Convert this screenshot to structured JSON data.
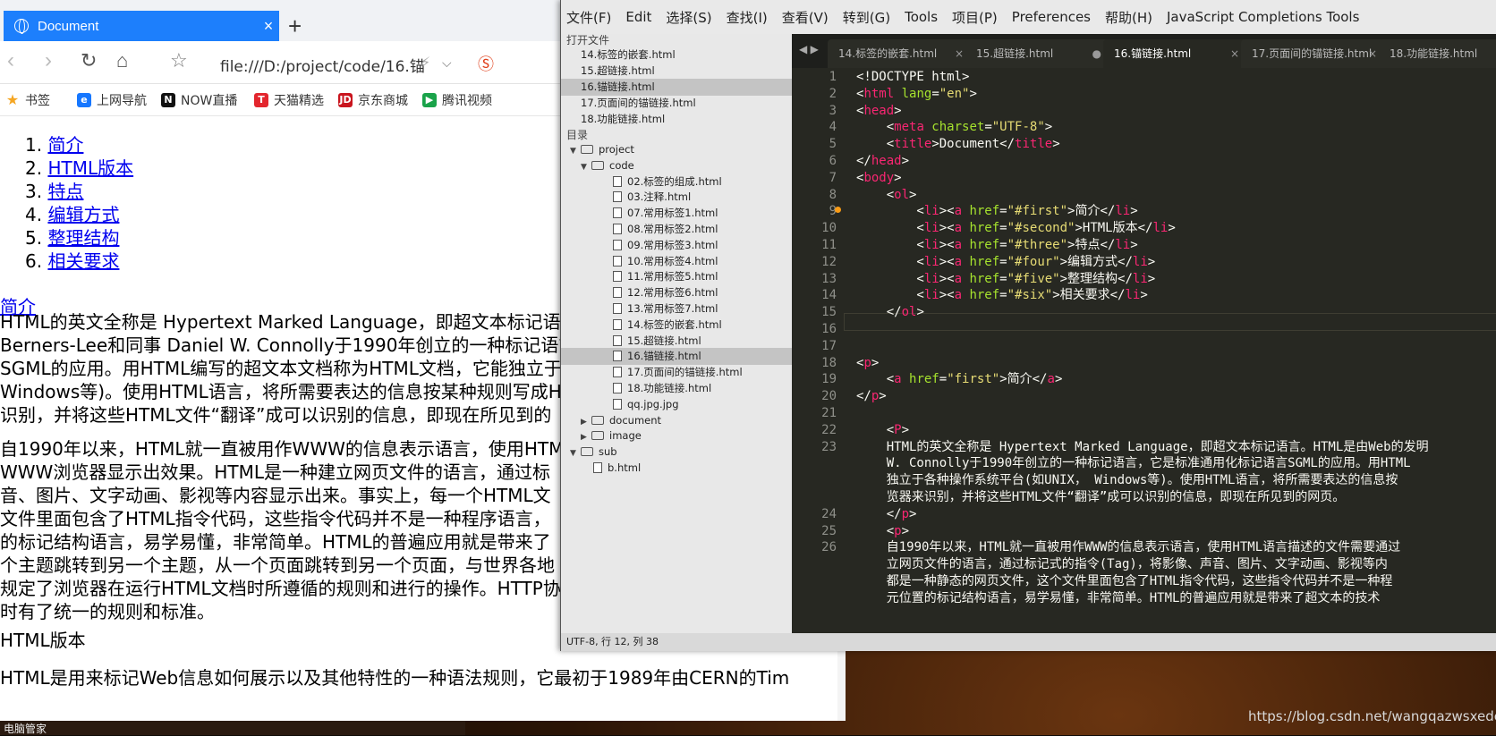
{
  "browser": {
    "tab_title": "Document",
    "url": "file:///D:/project/code/16.锚",
    "bookmarks": [
      "书签",
      "上网导航",
      "NOW直播",
      "天猫精选",
      "京东商城",
      "腾讯视频"
    ],
    "toc": [
      "1. 简介",
      "2. HTML版本",
      "3. 特点",
      "4. 编辑方式",
      "5. 整理结构",
      "6. 相关要求"
    ],
    "jump_link": "简介",
    "para1": "HTML的英文全称是 Hypertext Marked Language，即超文本标记语言\nBerners-Lee和同事 Daniel W. Connolly于1990年创立的一种标记语言\nSGML的应用。用HTML编写的超文本文档称为HTML文档，它能独立于\nWindows等)。使用HTML语言，将所需要表达的信息按某种规则写成H\n识别，并将这些HTML文件“翻译”成可以识别的信息，即现在所见到的",
    "para2": "自1990年以来，HTML就一直被用作WWW的信息表示语言，使用HTM\nWWW浏览器显示出效果。HTML是一种建立网页文件的语言，通过标\n音、图片、文字动画、影视等内容显示出来。事实上，每一个HTML文\n文件里面包含了HTML指令代码，这些指令代码并不是一种程序语言，\n的标记结构语言，易学易懂，非常简单。HTML的普遍应用就是带来了\n个主题跳转到另一个主题，从一个页面跳转到另一个页面，与世界各地\n规定了浏览器在运行HTML文档时所遵循的规则和进行的操作。HTTP协\n时有了统一的规则和标准。",
    "heading2": "HTML版本",
    "para3": "HTML是用来标记Web信息如何展示以及其他特性的一种语法规则，它最初于1989年由CERN的Tim"
  },
  "editor": {
    "menu": [
      "文件(F)",
      "Edit",
      "选择(S)",
      "查找(I)",
      "查看(V)",
      "转到(G)",
      "Tools",
      "项目(P)",
      "Preferences",
      "帮助(H)",
      "JavaScript Completions Tools"
    ],
    "sidebar_open_label": "打开文件",
    "open_files": [
      "14.标签的嵌套.html",
      "15.超链接.html",
      "16.锚链接.html",
      "17.页面间的锚链接.html",
      "18.功能链接.html"
    ],
    "folders_label": "目录",
    "tree": [
      {
        "label": "project",
        "level": 0,
        "kind": "folder-open"
      },
      {
        "label": "code",
        "level": 1,
        "kind": "folder-open"
      },
      {
        "label": "02.标签的组成.html",
        "level": 2,
        "kind": "file"
      },
      {
        "label": "03.注释.html",
        "level": 2,
        "kind": "file"
      },
      {
        "label": "07.常用标签1.html",
        "level": 2,
        "kind": "file"
      },
      {
        "label": "08.常用标签2.html",
        "level": 2,
        "kind": "file"
      },
      {
        "label": "09.常用标签3.html",
        "level": 2,
        "kind": "file"
      },
      {
        "label": "10.常用标签4.html",
        "level": 2,
        "kind": "file"
      },
      {
        "label": "11.常用标签5.html",
        "level": 2,
        "kind": "file"
      },
      {
        "label": "12.常用标签6.html",
        "level": 2,
        "kind": "file"
      },
      {
        "label": "13.常用标签7.html",
        "level": 2,
        "kind": "file"
      },
      {
        "label": "14.标签的嵌套.html",
        "level": 2,
        "kind": "file"
      },
      {
        "label": "15.超链接.html",
        "level": 2,
        "kind": "file"
      },
      {
        "label": "16.锚链接.html",
        "level": 2,
        "kind": "file",
        "selected": true
      },
      {
        "label": "17.页面间的锚链接.html",
        "level": 2,
        "kind": "file"
      },
      {
        "label": "18.功能链接.html",
        "level": 2,
        "kind": "file"
      },
      {
        "label": "qq.jpg.jpg",
        "level": 2,
        "kind": "image"
      },
      {
        "label": "document",
        "level": 1,
        "kind": "folder"
      },
      {
        "label": "image",
        "level": 1,
        "kind": "folder"
      },
      {
        "label": "sub",
        "level": 0,
        "kind": "folder-open"
      },
      {
        "label": "b.html",
        "level": 1,
        "kind": "file"
      }
    ],
    "tabs": [
      {
        "label": "14.标签的嵌套.html",
        "close": "×"
      },
      {
        "label": "15.超链接.html",
        "close": "●"
      },
      {
        "label": "16.锚链接.html",
        "close": "×",
        "active": true
      },
      {
        "label": "17.页面间的锚链接.html",
        "close": "×"
      },
      {
        "label": "18.功能链接.html",
        "close": "×"
      }
    ],
    "gutter": [
      "1",
      "2",
      "3",
      "4",
      "5",
      "6",
      "7",
      "8",
      "9",
      "10",
      "11",
      "12",
      "13",
      "14",
      "15",
      "16",
      "17",
      "18",
      "19",
      "20",
      "21",
      "22",
      "23",
      "",
      "",
      "",
      "24",
      "25",
      "26"
    ],
    "status": "UTF-8, 行 12, 列 38"
  },
  "code_lines": [
    [
      [
        "w",
        "<!DOCTYPE html>"
      ]
    ],
    [
      [
        "w",
        "<"
      ],
      [
        "t",
        "html"
      ],
      [
        "a",
        " lang"
      ],
      [
        "w",
        "="
      ],
      [
        "s",
        "\"en\""
      ],
      [
        "w",
        ">"
      ]
    ],
    [
      [
        "w",
        "<"
      ],
      [
        "t",
        "head"
      ],
      [
        "w",
        ">"
      ]
    ],
    [
      [
        "w",
        "    <"
      ],
      [
        "t",
        "meta"
      ],
      [
        "a",
        " charset"
      ],
      [
        "w",
        "="
      ],
      [
        "s",
        "\"UTF-8\""
      ],
      [
        "w",
        ">"
      ]
    ],
    [
      [
        "w",
        "    <"
      ],
      [
        "t",
        "title"
      ],
      [
        "w",
        ">Document</"
      ],
      [
        "t",
        "title"
      ],
      [
        "w",
        ">"
      ]
    ],
    [
      [
        "w",
        "</"
      ],
      [
        "t",
        "head"
      ],
      [
        "w",
        ">"
      ]
    ],
    [
      [
        "w",
        "<"
      ],
      [
        "t",
        "body"
      ],
      [
        "w",
        ">"
      ]
    ],
    [
      [
        "w",
        "    <"
      ],
      [
        "t",
        "ol"
      ],
      [
        "w",
        ">"
      ]
    ],
    [
      [
        "w",
        "        <"
      ],
      [
        "t",
        "li"
      ],
      [
        "w",
        "><"
      ],
      [
        "t",
        "a"
      ],
      [
        "a",
        " href"
      ],
      [
        "w",
        "="
      ],
      [
        "s",
        "\"#first\""
      ],
      [
        "w",
        ">简介</"
      ],
      [
        "t",
        "li"
      ],
      [
        "w",
        ">"
      ]
    ],
    [
      [
        "w",
        "        <"
      ],
      [
        "t",
        "li"
      ],
      [
        "w",
        "><"
      ],
      [
        "t",
        "a"
      ],
      [
        "a",
        " href"
      ],
      [
        "w",
        "="
      ],
      [
        "s",
        "\"#second\""
      ],
      [
        "w",
        ">HTML版本</"
      ],
      [
        "t",
        "li"
      ],
      [
        "w",
        ">"
      ]
    ],
    [
      [
        "w",
        "        <"
      ],
      [
        "t",
        "li"
      ],
      [
        "w",
        "><"
      ],
      [
        "t",
        "a"
      ],
      [
        "a",
        " href"
      ],
      [
        "w",
        "="
      ],
      [
        "s",
        "\"#three\""
      ],
      [
        "w",
        ">特点</"
      ],
      [
        "t",
        "li"
      ],
      [
        "w",
        ">"
      ]
    ],
    [
      [
        "w",
        "        <"
      ],
      [
        "t",
        "li"
      ],
      [
        "w",
        "><"
      ],
      [
        "t",
        "a"
      ],
      [
        "a",
        " href"
      ],
      [
        "w",
        "="
      ],
      [
        "s",
        "\"#four\""
      ],
      [
        "w",
        ">编辑方式</"
      ],
      [
        "t",
        "li"
      ],
      [
        "w",
        ">"
      ]
    ],
    [
      [
        "w",
        "        <"
      ],
      [
        "t",
        "li"
      ],
      [
        "w",
        "><"
      ],
      [
        "t",
        "a"
      ],
      [
        "a",
        " href"
      ],
      [
        "w",
        "="
      ],
      [
        "s",
        "\"#five\""
      ],
      [
        "w",
        ">整理结构</"
      ],
      [
        "t",
        "li"
      ],
      [
        "w",
        ">"
      ]
    ],
    [
      [
        "w",
        "        <"
      ],
      [
        "t",
        "li"
      ],
      [
        "w",
        "><"
      ],
      [
        "t",
        "a"
      ],
      [
        "a",
        " href"
      ],
      [
        "w",
        "="
      ],
      [
        "s",
        "\"#six\""
      ],
      [
        "w",
        ">相关要求</"
      ],
      [
        "t",
        "li"
      ],
      [
        "w",
        ">"
      ]
    ],
    [
      [
        "w",
        "    </"
      ],
      [
        "t",
        "ol"
      ],
      [
        "w",
        ">"
      ]
    ],
    [],
    [],
    [
      [
        "w",
        "<"
      ],
      [
        "t",
        "p"
      ],
      [
        "w",
        ">"
      ]
    ],
    [
      [
        "w",
        "    <"
      ],
      [
        "t",
        "a"
      ],
      [
        "a",
        " href"
      ],
      [
        "w",
        "="
      ],
      [
        "s",
        "\"first\""
      ],
      [
        "w",
        ">简介</"
      ],
      [
        "t",
        "a"
      ],
      [
        "w",
        ">"
      ]
    ],
    [
      [
        "w",
        "</"
      ],
      [
        "t",
        "p"
      ],
      [
        "w",
        ">"
      ]
    ],
    [],
    [
      [
        "w",
        "    <"
      ],
      [
        "t",
        "P"
      ],
      [
        "w",
        ">"
      ]
    ],
    [
      [
        "w",
        "    HTML的英文全称是 Hypertext Marked Language，即超文本标记语言。HTML是由Web的发明"
      ]
    ],
    [
      [
        "w",
        "    W. Connolly于1990年创立的一种标记语言，它是标准通用化标记语言SGML的应用。用HTML"
      ]
    ],
    [
      [
        "w",
        "    独立于各种操作系统平台(如UNIX， Windows等)。使用HTML语言，将所需要表达的信息按"
      ]
    ],
    [
      [
        "w",
        "    览器来识别，并将这些HTML文件“翻译”成可以识别的信息，即现在所见到的网页。"
      ]
    ],
    [
      [
        "w",
        "    </"
      ],
      [
        "t",
        "p"
      ],
      [
        "w",
        ">"
      ]
    ],
    [
      [
        "w",
        "    <"
      ],
      [
        "t",
        "p"
      ],
      [
        "w",
        ">"
      ]
    ],
    [
      [
        "w",
        "    自1990年以来，HTML就一直被用作WWW的信息表示语言，使用HTML语言描述的文件需要通过"
      ]
    ],
    [
      [
        "w",
        "    立网页文件的语言，通过标记式的指令(Tag)，将影像、声音、图片、文字动画、影视等内"
      ]
    ],
    [
      [
        "w",
        "    都是一种静态的网页文件，这个文件里面包含了HTML指令代码，这些指令代码并不是一种程"
      ]
    ],
    [
      [
        "w",
        "    元位置的标记结构语言，易学易懂，非常简单。HTML的普遍应用就是带来了超文本的技术"
      ]
    ]
  ],
  "watermark": "https://blog.csdn.net/wangqazwsxedc",
  "taskbar_text": "电脑管家"
}
